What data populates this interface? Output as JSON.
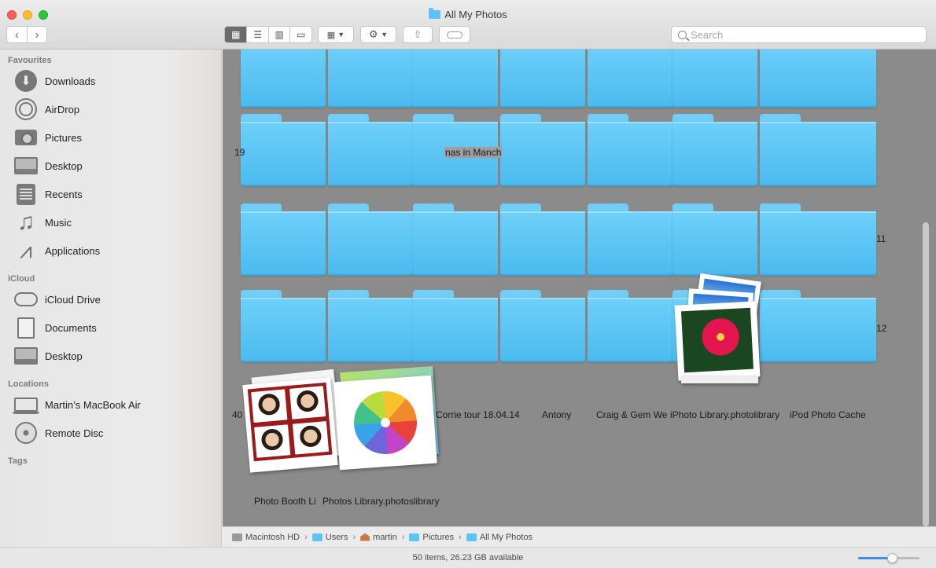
{
  "window": {
    "title": "All My Photos"
  },
  "toolbar": {
    "back_icon": "chevron-left-icon",
    "forward_icon": "chevron-right-icon",
    "view_modes": [
      "icon-view",
      "list-view",
      "column-view",
      "gallery-view"
    ],
    "active_view": "icon-view",
    "search": {
      "placeholder": "Search",
      "value": ""
    }
  },
  "sidebar": {
    "sections": [
      {
        "title": "Favourites",
        "items": [
          {
            "label": "Downloads",
            "icon": "downloads-icon"
          },
          {
            "label": "AirDrop",
            "icon": "airdrop-icon"
          },
          {
            "label": "Pictures",
            "icon": "camera-icon"
          },
          {
            "label": "Desktop",
            "icon": "desktop-icon"
          },
          {
            "label": "Recents",
            "icon": "recents-icon"
          },
          {
            "label": "Music",
            "icon": "music-icon"
          },
          {
            "label": "Applications",
            "icon": "applications-icon"
          }
        ]
      },
      {
        "title": "iCloud",
        "items": [
          {
            "label": "iCloud Drive",
            "icon": "cloud-icon"
          },
          {
            "label": "Documents",
            "icon": "document-icon"
          },
          {
            "label": "Desktop",
            "icon": "desktop-icon"
          }
        ]
      },
      {
        "title": "Locations",
        "items": [
          {
            "label": "Martin’s MacBook Air",
            "icon": "laptop-icon"
          },
          {
            "label": "Remote Disc",
            "icon": "disc-icon"
          }
        ]
      },
      {
        "title": "Tags",
        "items": []
      }
    ]
  },
  "content": {
    "partial_labels": {
      "r2_left": "19",
      "r2_selected": "nas in Manch",
      "r3_right": "11",
      "r4_right": "12",
      "r5_left": "40"
    },
    "row5_labels": [
      "Corrie tour 18.04.14",
      "Antony",
      "Craig & Gem We",
      "iPhoto Library.photolibrary",
      "iPod Photo Cache"
    ],
    "row6_labels": {
      "booth": "Photo Booth Li",
      "photos": "Photos Library.photoslibrary"
    }
  },
  "pathbar": {
    "crumbs": [
      "Macintosh HD",
      "Users",
      "martin",
      "Pictures",
      "All My Photos"
    ]
  },
  "status": {
    "text": "50 items, 26.23 GB available",
    "zoom_level": 0.55
  }
}
